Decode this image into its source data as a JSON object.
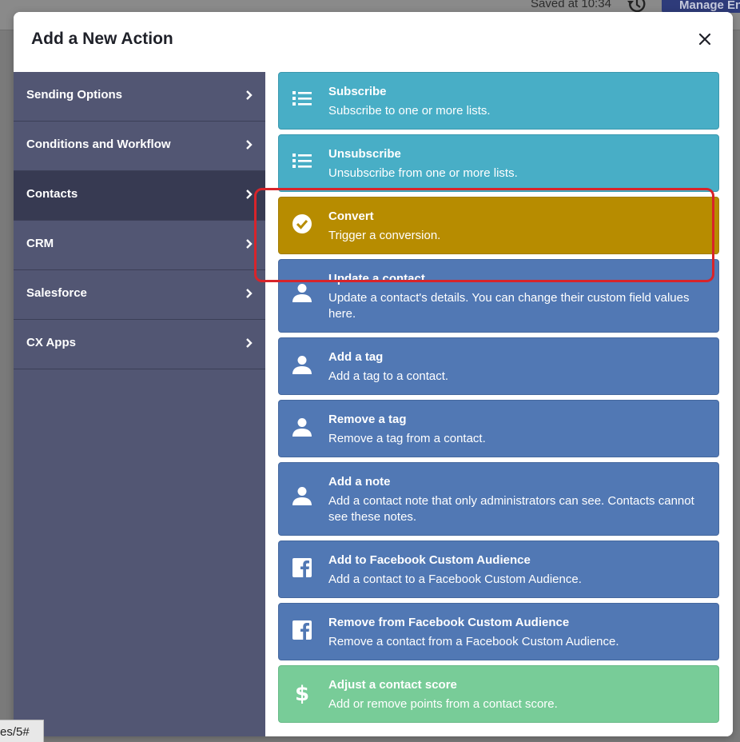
{
  "background": {
    "saved_text": "Saved at 10:34",
    "manage_label": "Manage En",
    "status_url": "es/5#"
  },
  "modal": {
    "title": "Add a New Action",
    "close_icon": "close-icon"
  },
  "sidebar": {
    "items": [
      {
        "label": "Sending Options"
      },
      {
        "label": "Conditions and Workflow"
      },
      {
        "label": "Contacts",
        "active": true
      },
      {
        "label": "CRM"
      },
      {
        "label": "Salesforce"
      },
      {
        "label": "CX Apps"
      }
    ]
  },
  "actions": [
    {
      "title": "Subscribe",
      "desc": "Subscribe to one or more lists.",
      "icon": "list-icon",
      "color": "#48aec6"
    },
    {
      "title": "Unsubscribe",
      "desc": "Unsubscribe from one or more lists.",
      "icon": "list-icon",
      "color": "#48aec6"
    },
    {
      "title": "Convert",
      "desc": "Trigger a conversion.",
      "icon": "check-circle-icon",
      "color": "#b78c00"
    },
    {
      "title": "Update a contact",
      "desc": "Update a contact's details. You can change their custom field values here.",
      "icon": "user-icon",
      "color": "#5178b4",
      "highlighted": true
    },
    {
      "title": "Add a tag",
      "desc": "Add a tag to a contact.",
      "icon": "user-icon",
      "color": "#5178b4"
    },
    {
      "title": "Remove a tag",
      "desc": "Remove a tag from a contact.",
      "icon": "user-icon",
      "color": "#5178b4"
    },
    {
      "title": "Add a note",
      "desc": "Add a contact note that only administrators can see. Contacts cannot see these notes.",
      "icon": "user-icon",
      "color": "#5178b4"
    },
    {
      "title": "Add to Facebook Custom Audience",
      "desc": "Add a contact to a Facebook Custom Audience.",
      "icon": "facebook-icon",
      "color": "#5178b4"
    },
    {
      "title": "Remove from Facebook Custom Audience",
      "desc": "Remove a contact from a Facebook Custom Audience.",
      "icon": "facebook-icon",
      "color": "#5178b4"
    },
    {
      "title": "Adjust a contact score",
      "desc": "Add or remove points from a contact score.",
      "icon": "dollar-icon",
      "color": "#78cc98"
    }
  ]
}
